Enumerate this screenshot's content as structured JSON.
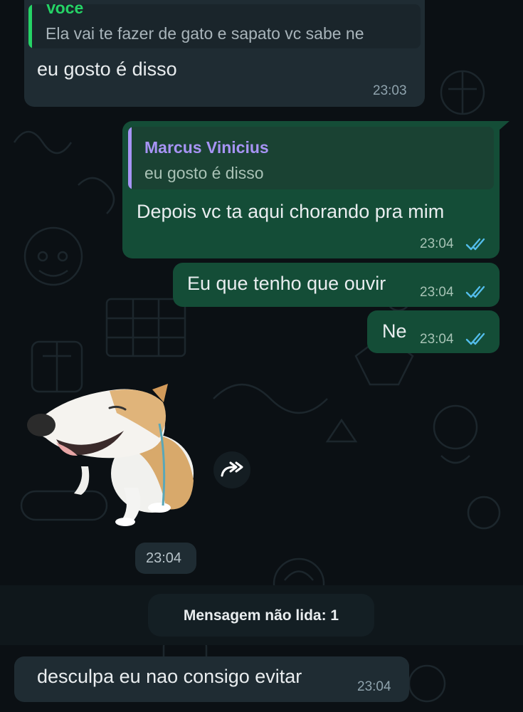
{
  "messages": {
    "m1": {
      "quote_author": "Você",
      "quote_text": "Ela vai te fazer de gato e sapato vc sabe ne",
      "text": "eu gosto é disso",
      "time": "23:03"
    },
    "m2": {
      "quote_author": "Marcus Vinicius",
      "quote_text": "eu gosto é disso",
      "text": "Depois vc ta aqui chorando pra mim",
      "time": "23:04"
    },
    "m3": {
      "text": "Eu que tenho que ouvir",
      "time": "23:04"
    },
    "m4": {
      "text": "Ne",
      "time": "23:04"
    },
    "sticker": {
      "time": "23:04",
      "icon": "forward-icon"
    },
    "m6": {
      "text": "desculpa eu nao consigo evitar",
      "time": "23:04"
    }
  },
  "unread_banner": {
    "label": "Mensagem não lida: 1"
  },
  "colors": {
    "incoming_bubble": "#1f2c33",
    "outgoing_bubble": "#144d37",
    "quote_green": "#25d366",
    "quote_purple": "#a794f5",
    "read_ticks": "#53bdeb"
  }
}
